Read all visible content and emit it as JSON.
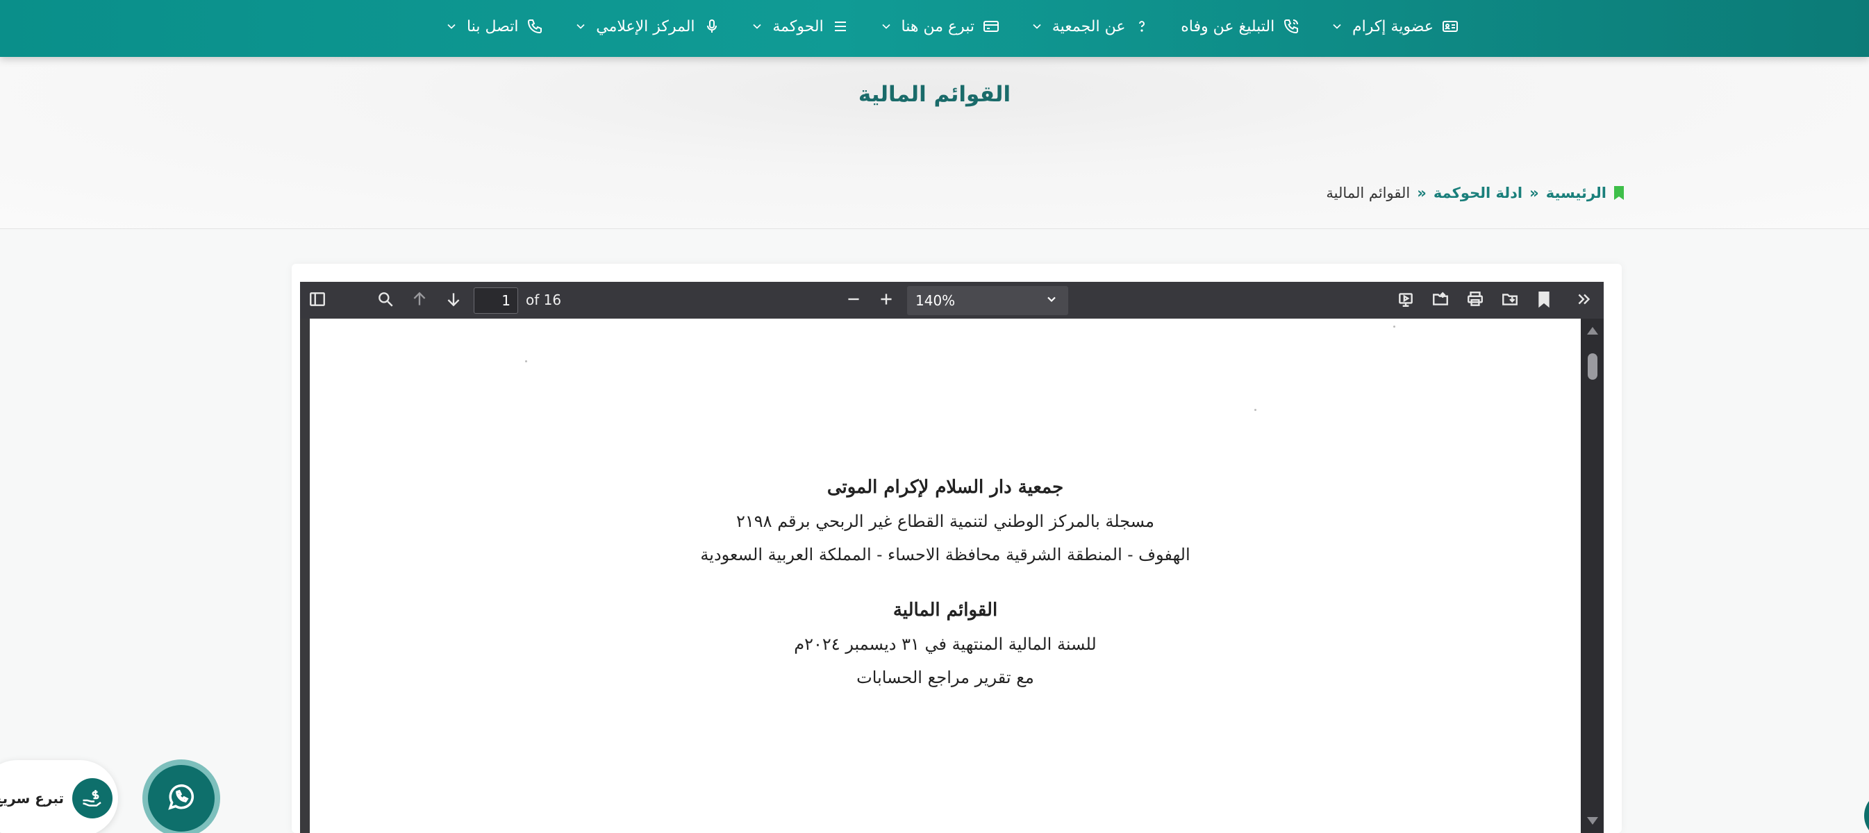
{
  "nav": {
    "items": [
      {
        "label": "عضوية إكرام",
        "icon": "id-card-icon",
        "has_dropdown": true
      },
      {
        "label": "التبليغ عن وفاه",
        "icon": "phone-call-icon",
        "has_dropdown": false
      },
      {
        "label": "عن الجمعية",
        "icon": "question-icon",
        "has_dropdown": true
      },
      {
        "label": "تبرع من هنا",
        "icon": "credit-card-icon",
        "has_dropdown": true
      },
      {
        "label": "الحوكمة",
        "icon": "list-icon",
        "has_dropdown": true
      },
      {
        "label": "المركز الإعلامي",
        "icon": "microphone-icon",
        "has_dropdown": true
      },
      {
        "label": "اتصل بنا",
        "icon": "phone-icon",
        "has_dropdown": true
      }
    ]
  },
  "page": {
    "title": "القوائم المالية"
  },
  "breadcrumb": {
    "home": "الرئيسية",
    "sep": "»",
    "parent": "ادلة الحوكمة",
    "current": "القوائم المالية"
  },
  "pdf_viewer": {
    "page_number": "1",
    "page_count_label": "of 16",
    "zoom": "140%"
  },
  "document": {
    "org_name": "جمعية دار السلام لإكرام الموتى",
    "registration": "مسجلة بالمركز الوطني لتنمية القطاع غير الربحي برقم ٢١٩٨",
    "location": "الهفوف - المنطقة الشرقية محافظة الاحساء - المملكة العربية السعودية",
    "statement_title": "القوائم المالية",
    "period": "للسنة المالية المنتهية في ٣١ ديسمبر ٢٠٢٤م",
    "auditor": "مع تقرير مراجع الحسابات"
  },
  "widgets": {
    "quick_donate": "تبرع سريع"
  },
  "colors": {
    "brand": "#0f8f89",
    "brand_dark": "#0e6f6b",
    "title": "#1a6b6a",
    "bookmark": "#3fbf4a"
  }
}
